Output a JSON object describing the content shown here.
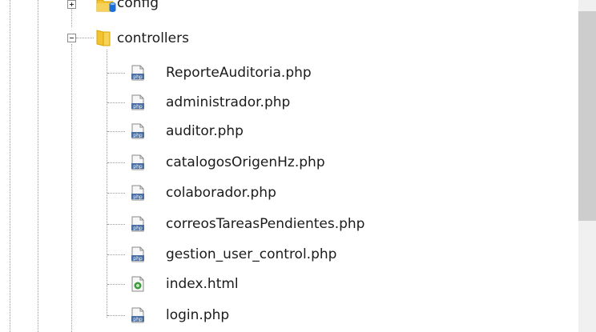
{
  "tree": {
    "top_item": {
      "label": "config",
      "icon": "folder-with-db-icon",
      "expanded": false
    },
    "folder": {
      "label": "controllers",
      "icon": "folder-open-icon",
      "expanded": true
    },
    "files": [
      {
        "label": "ReporteAuditoria.php",
        "icon": "php-file-icon"
      },
      {
        "label": "administrador.php",
        "icon": "php-file-icon"
      },
      {
        "label": "auditor.php",
        "icon": "php-file-icon"
      },
      {
        "label": "catalogosOrigenHz.php",
        "icon": "php-file-icon"
      },
      {
        "label": "colaborador.php",
        "icon": "php-file-icon"
      },
      {
        "label": "correosTareasPendientes.php",
        "icon": "php-file-icon"
      },
      {
        "label": "gestion_user_control.php",
        "icon": "php-file-icon"
      },
      {
        "label": "index.html",
        "icon": "html-file-icon"
      },
      {
        "label": "login.php",
        "icon": "php-file-icon"
      }
    ]
  },
  "colors": {
    "folder": "#f4c430",
    "folder_dark": "#d9a400",
    "php_badge": "#4a6fa5",
    "html_badge": "#3b9a3b",
    "scroll_track": "#f0f0f0",
    "scroll_thumb": "#cdcdcd"
  }
}
